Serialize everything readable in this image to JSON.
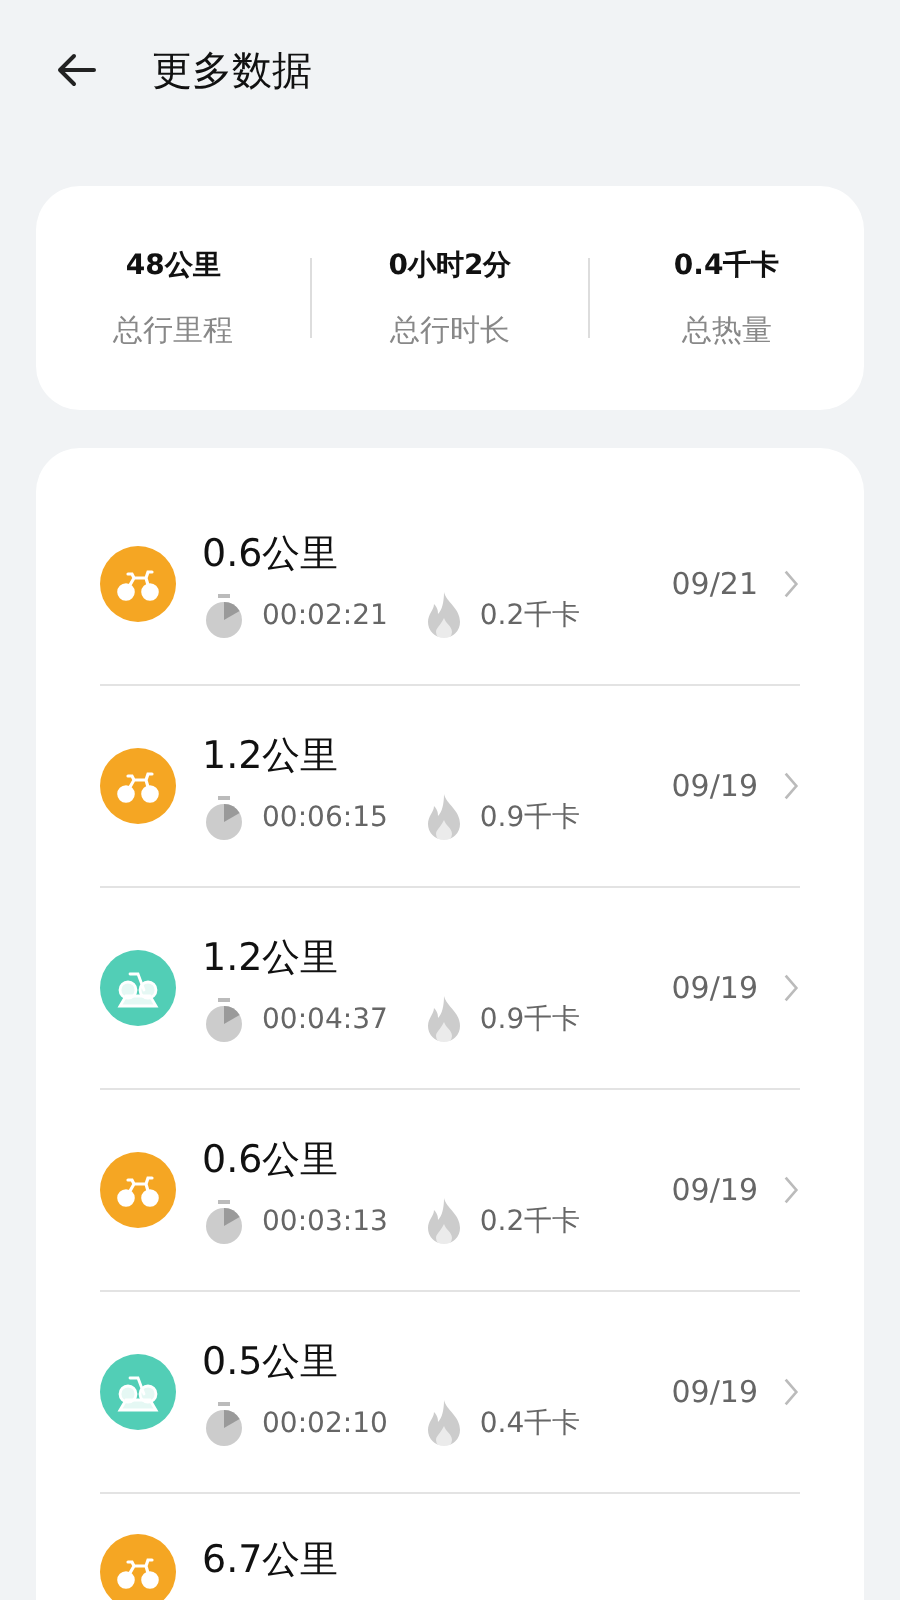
{
  "header": {
    "title": "更多数据"
  },
  "summary": [
    {
      "value": "48公里",
      "label": "总行里程"
    },
    {
      "value": "0小时2分",
      "label": "总行时长"
    },
    {
      "value": "0.4千卡",
      "label": "总热量"
    }
  ],
  "records": [
    {
      "kind": "bike",
      "distance": "0.6公里",
      "duration": "00:02:21",
      "calories": "0.2千卡",
      "date": "09/21"
    },
    {
      "kind": "bike",
      "distance": "1.2公里",
      "duration": "00:06:15",
      "calories": "0.9千卡",
      "date": "09/19"
    },
    {
      "kind": "spin",
      "distance": "1.2公里",
      "duration": "00:04:37",
      "calories": "0.9千卡",
      "date": "09/19"
    },
    {
      "kind": "bike",
      "distance": "0.6公里",
      "duration": "00:03:13",
      "calories": "0.2千卡",
      "date": "09/19"
    },
    {
      "kind": "spin",
      "distance": "0.5公里",
      "duration": "00:02:10",
      "calories": "0.4千卡",
      "date": "09/19"
    },
    {
      "kind": "bike",
      "distance": "6.7公里"
    }
  ]
}
